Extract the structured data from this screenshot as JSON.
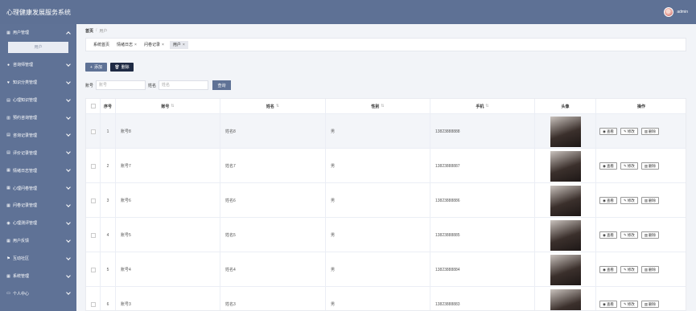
{
  "app": {
    "title": "心理健康发展服务系统",
    "username": "admin"
  },
  "sidebar": {
    "items": [
      {
        "label": "用户管理",
        "icon": "grid-icon",
        "open": true,
        "sub": [
          "用户"
        ]
      },
      {
        "label": "咨询师管理",
        "icon": "user-icon"
      },
      {
        "label": "知识分类管理",
        "icon": "heart-icon"
      },
      {
        "label": "心理知识管理",
        "icon": "doc-icon"
      },
      {
        "label": "预约咨询管理",
        "icon": "note-icon"
      },
      {
        "label": "咨询记录管理",
        "icon": "doc-icon"
      },
      {
        "label": "评价记录管理",
        "icon": "doc-icon"
      },
      {
        "label": "情绪日志管理",
        "icon": "grid-icon"
      },
      {
        "label": "心理问卷管理",
        "icon": "grid-icon"
      },
      {
        "label": "问卷记录管理",
        "icon": "grid-icon"
      },
      {
        "label": "心理测评管理",
        "icon": "pin-icon"
      },
      {
        "label": "用户反馈",
        "icon": "grid-icon"
      },
      {
        "label": "互动社区",
        "icon": "flag-icon"
      },
      {
        "label": "系统管理",
        "icon": "grid-icon"
      },
      {
        "label": "个人中心",
        "icon": "card-icon"
      }
    ]
  },
  "breadcrumb": {
    "home": "首页",
    "sep": "/",
    "current": "用户"
  },
  "tabs": [
    {
      "label": "系统首页",
      "closable": false
    },
    {
      "label": "情绪日志",
      "closable": true
    },
    {
      "label": "问卷记录",
      "closable": true
    },
    {
      "label": "用户",
      "closable": true,
      "active": true
    }
  ],
  "toolbar": {
    "add_label": "添加",
    "delete_label": "删除"
  },
  "search": {
    "account_label": "账号",
    "account_placeholder": "账号",
    "name_label": "姓名",
    "name_placeholder": "姓名",
    "query_label": "查询"
  },
  "table": {
    "columns": [
      "序号",
      "账号",
      "姓名",
      "性别",
      "手机",
      "头像",
      "操作"
    ],
    "rows": [
      {
        "no": "1",
        "account": "账号8",
        "name": "姓名8",
        "gender": "男",
        "phone": "13823888888"
      },
      {
        "no": "2",
        "account": "账号7",
        "name": "姓名7",
        "gender": "男",
        "phone": "13823888887"
      },
      {
        "no": "3",
        "account": "账号6",
        "name": "姓名6",
        "gender": "男",
        "phone": "13823888886"
      },
      {
        "no": "4",
        "account": "账号5",
        "name": "姓名5",
        "gender": "男",
        "phone": "13823888885"
      },
      {
        "no": "5",
        "account": "账号4",
        "name": "姓名4",
        "gender": "男",
        "phone": "13823888884"
      },
      {
        "no": "6",
        "account": "账号3",
        "name": "姓名3",
        "gender": "男",
        "phone": "13823888883"
      }
    ],
    "actions": {
      "view": "查看",
      "edit": "修改",
      "delete": "删除"
    }
  },
  "colors": {
    "primary": "#5f7296",
    "dark_button": "#1f2a44",
    "background": "#f2f4f8"
  }
}
